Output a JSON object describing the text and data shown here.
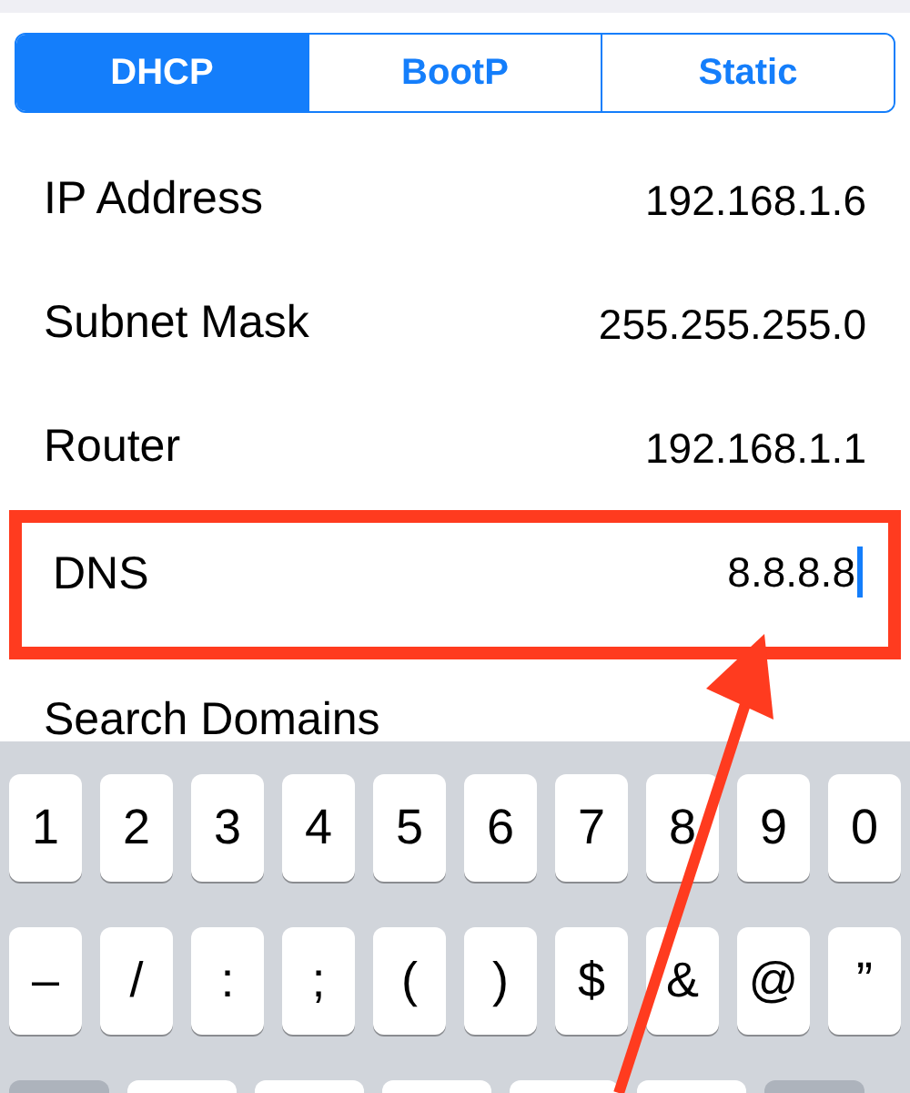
{
  "segments": [
    {
      "label": "DHCP",
      "selected": true
    },
    {
      "label": "BootP",
      "selected": false
    },
    {
      "label": "Static",
      "selected": false
    }
  ],
  "rows": [
    {
      "label": "IP Address",
      "value": "192.168.1.6",
      "highlighted": false,
      "editing": false
    },
    {
      "label": "Subnet Mask",
      "value": "255.255.255.0",
      "highlighted": false,
      "editing": false
    },
    {
      "label": "Router",
      "value": "192.168.1.1",
      "highlighted": false,
      "editing": false
    },
    {
      "label": "DNS",
      "value": "8.8.8.8",
      "highlighted": true,
      "editing": true
    },
    {
      "label": "Search Domains",
      "highlighted": false,
      "editing": false
    }
  ],
  "keyboard": {
    "rows": [
      [
        "1",
        "2",
        "3",
        "4",
        "5",
        "6",
        "7",
        "8",
        "9",
        "0"
      ],
      [
        "–",
        "/",
        ":",
        ";",
        "(",
        ")",
        "$",
        "&",
        "@",
        "”"
      ]
    ]
  }
}
